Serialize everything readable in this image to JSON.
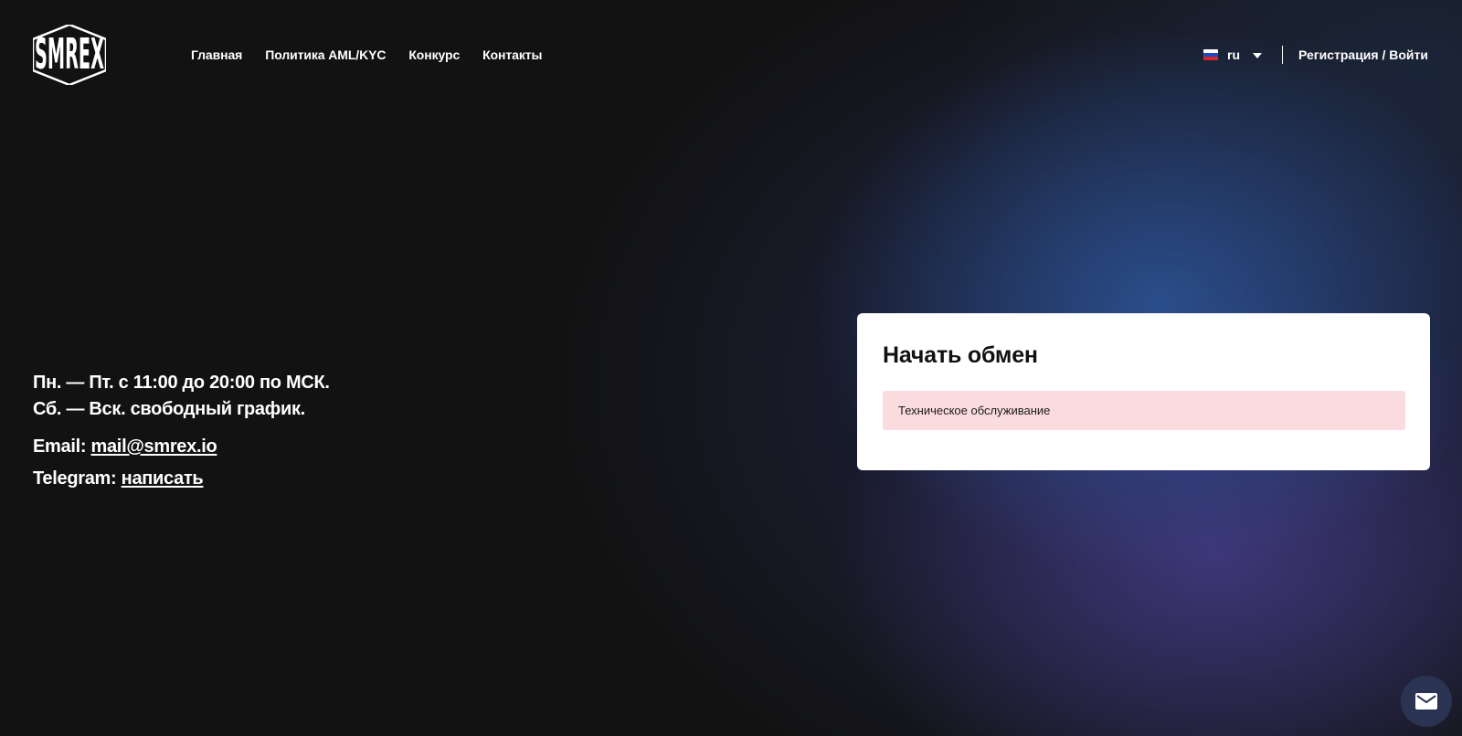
{
  "brand": {
    "logo_text": "SMREX"
  },
  "nav": {
    "items": [
      {
        "label": "Главная"
      },
      {
        "label": "Политика AML/KYC"
      },
      {
        "label": "Конкурс"
      },
      {
        "label": "Контакты"
      }
    ]
  },
  "lang": {
    "label": "ru"
  },
  "auth": {
    "label": "Регистрация / Войти"
  },
  "info": {
    "schedule_weekdays": "Пн. — Пт. с 11:00 до 20:00 по МСК.",
    "schedule_weekend": "Сб. — Вск. свободный график.",
    "email_label": "Email:",
    "email_value": "mail@smrex.io",
    "telegram_label": "Telegram:",
    "telegram_link": "написать"
  },
  "exchange": {
    "title": "Начать обмен",
    "alert": "Техническое обслуживание"
  },
  "colors": {
    "background": "#121212",
    "alert_bg": "#fbdcde",
    "fab_bg": "#2b3352"
  }
}
